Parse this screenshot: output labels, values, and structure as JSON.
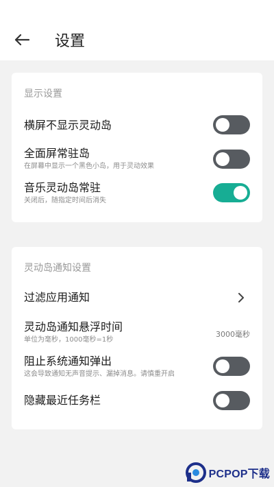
{
  "header": {
    "title": "设置"
  },
  "display_section": {
    "title": "显示设置",
    "items": [
      {
        "label": "横屏不显示灵动岛",
        "sub": "",
        "toggle_on": false
      },
      {
        "label": "全面屏常驻岛",
        "sub": "在屏幕中显示一个黑色小岛，用于灵动效果",
        "toggle_on": false
      },
      {
        "label": "音乐灵动岛常驻",
        "sub": "关闭后，随指定时间后消失",
        "toggle_on": true
      }
    ]
  },
  "notify_section": {
    "title": "灵动岛通知设置",
    "filter_label": "过滤应用通知",
    "float_time": {
      "label": "灵动岛通知悬浮时间",
      "sub": "单位为毫秒，1000毫秒=1秒",
      "value": "3000毫秒"
    },
    "block": {
      "label": "阻止系统通知弹出",
      "sub": "这会导致通知无声音提示、漏掉消息。请慎重开启",
      "toggle_on": false
    },
    "hide_recent": {
      "label": "隐藏最近任务栏",
      "toggle_on": false
    }
  },
  "watermark": {
    "text": "PCPOP下载"
  },
  "colors": {
    "accent": "#17ad94",
    "toggle_off": "#575b60"
  }
}
